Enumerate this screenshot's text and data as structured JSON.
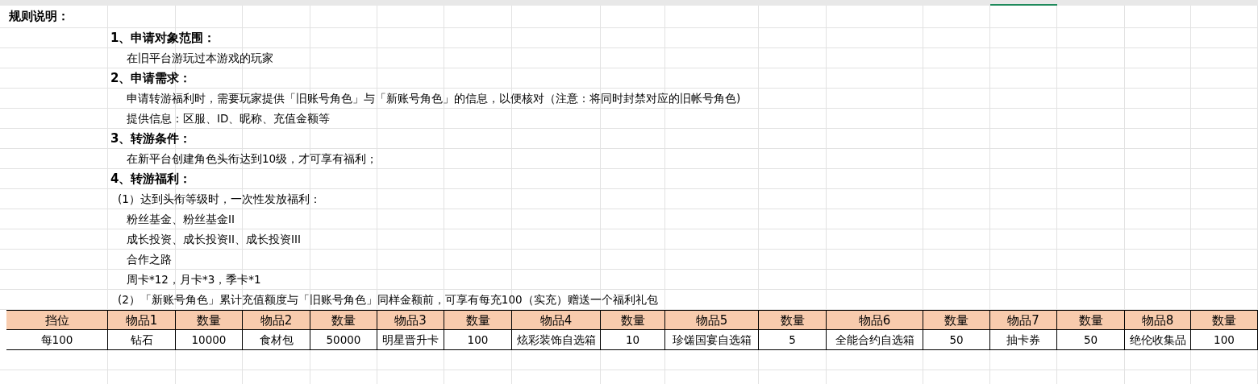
{
  "rules": {
    "title": "规则说明：",
    "lines": [
      {
        "kind": "heading",
        "text": "1、申请对象范围："
      },
      {
        "kind": "item",
        "text": "在旧平台游玩过本游戏的玩家"
      },
      {
        "kind": "heading",
        "text": "2、申请需求："
      },
      {
        "kind": "item",
        "text": "申请转游福利时，需要玩家提供「旧账号角色」与「新账号角色」的信息，以便核对（注意：将同时封禁对应的旧帐号角色)"
      },
      {
        "kind": "item",
        "text": "提供信息：区服、ID、昵称、充值金额等"
      },
      {
        "kind": "heading",
        "text": "3、转游条件："
      },
      {
        "kind": "item",
        "text": "在新平台创建角色头衔达到10级，才可享有福利；"
      },
      {
        "kind": "heading",
        "text": "4、转游福利："
      },
      {
        "kind": "sub",
        "text": "(1）达到头衔等级时，一次性发放福利："
      },
      {
        "kind": "item",
        "text": "粉丝基金、粉丝基金II"
      },
      {
        "kind": "item",
        "text": "成长投资、成长投资II、成长投资III"
      },
      {
        "kind": "item",
        "text": "合作之路"
      },
      {
        "kind": "item",
        "text": "周卡*12，月卡*3，季卡*1"
      },
      {
        "kind": "sub",
        "text": "(2）「新账号角色」累计充值额度与「旧账号角色」同样金额前，可享有每充100（实充）赠送一个福利礼包"
      }
    ]
  },
  "table": {
    "columns": [
      "挡位",
      "物品1",
      "数量",
      "物品2",
      "数量",
      "物品3",
      "数量",
      "物品4",
      "数量",
      "物品5",
      "数量",
      "物品6",
      "数量",
      "物品7",
      "数量",
      "物品8",
      "数量"
    ],
    "rows": [
      [
        "每100",
        "钻石",
        "10000",
        "食材包",
        "50000",
        "明星晋升卡",
        "100",
        "炫彩装饰自选箱",
        "10",
        "珍馐国宴自选箱",
        "5",
        "全能合约自选箱",
        "50",
        "抽卡券",
        "50",
        "绝伦收集品",
        "100"
      ]
    ]
  }
}
